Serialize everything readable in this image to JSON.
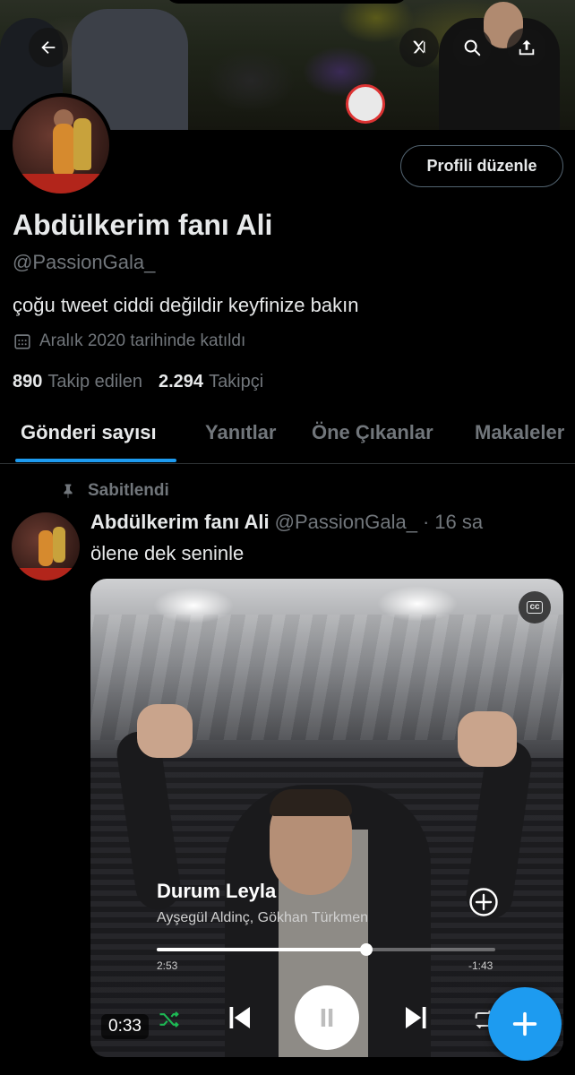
{
  "header": {
    "back_icon": "arrow-left-icon",
    "grok_icon": "grok-icon",
    "search_icon": "search-icon",
    "share_icon": "share-upload-icon"
  },
  "profile": {
    "edit_button_label": "Profili düzenle",
    "display_name": "Abdülkerim fanı Ali",
    "handle": "@PassionGala_",
    "bio": "çoğu tweet ciddi değildir keyfinize bakın",
    "joined": "Aralık 2020 tarihinde katıldı",
    "following_count": "890",
    "following_label": "Takip edilen",
    "followers_count": "2.294",
    "followers_label": "Takipçi"
  },
  "tabs": [
    {
      "label": "Gönderi sayısı",
      "active": true
    },
    {
      "label": "Yanıtlar",
      "active": false
    },
    {
      "label": "Öne Çıkanlar",
      "active": false
    },
    {
      "label": "Makaleler",
      "active": false
    }
  ],
  "tweet": {
    "pinned_label": "Sabitlendi",
    "author_name": "Abdülkerim fanı Ali",
    "author_handle": "@PassionGala_",
    "separator": "·",
    "time": "16 sa",
    "text": "ölene dek seninle",
    "media": {
      "cc_label": "cc",
      "song_title": "Durum Leyla",
      "song_artist": "Ayşegül Aldinç, Gökhan Türkmen",
      "time_elapsed": "2:53",
      "time_remaining": "-1:43",
      "progress_fraction": 0.62,
      "video_timer": "0:33"
    }
  },
  "colors": {
    "accent": "#1d9bf0",
    "background": "#000000",
    "secondary_text": "#71767b",
    "primary_text": "#e7e9ea",
    "divider": "#2f3336"
  },
  "fab": {
    "icon": "plus-icon"
  }
}
